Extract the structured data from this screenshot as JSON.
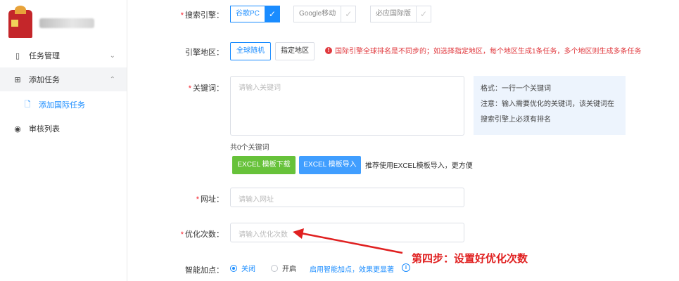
{
  "sidebar": {
    "items": [
      {
        "label": "任务管理",
        "icon": "file-icon",
        "chevron": "⌄"
      },
      {
        "label": "添加任务",
        "icon": "plus-box-icon",
        "chevron": "⌃"
      },
      {
        "label": "添加国际任务",
        "icon": "document-icon"
      },
      {
        "label": "审核列表",
        "icon": "eye-icon"
      }
    ]
  },
  "form": {
    "engine": {
      "label": "搜索引擎：",
      "options": [
        {
          "label": "谷歌PC",
          "checked": true
        },
        {
          "label": "Google移动",
          "checked": false
        },
        {
          "label": "必应国际版",
          "checked": false
        }
      ]
    },
    "region": {
      "label": "引擎地区：",
      "random_label": "全球随机",
      "specify_label": "指定地区",
      "warning": "国际引擎全球排名是不同步的；如选择指定地区，每个地区生成1条任务，多个地区则生成多条任务"
    },
    "keywords": {
      "label": "关键词：",
      "placeholder": "请输入关键词",
      "hint_line1": "格式：一行一个关键词",
      "hint_line2": "注意：输入需要优化的关键词，该关键词在",
      "hint_line3": "搜索引擎上必须有排名",
      "count_text": "共0个关键词",
      "download_label": "EXCEL 模板下载",
      "import_label": "EXCEL 模板导入",
      "import_tip": "推荐使用EXCEL模板导入，更方便"
    },
    "url": {
      "label": "网址：",
      "placeholder": "请输入网址"
    },
    "optimize_count": {
      "label": "优化次数：",
      "placeholder": "请输入优化次数"
    },
    "smart_boost": {
      "label": "智能加点：",
      "off_label": "关闭",
      "on_label": "开启",
      "selected": "关闭",
      "link": "启用智能加点，效果更显著"
    }
  },
  "annotation": {
    "text": "第四步：设置好优化次数",
    "color": "#e02020"
  },
  "colors": {
    "accent": "#1a8cff",
    "danger": "#e0383d",
    "green": "#67c23a",
    "blue": "#409eff"
  }
}
